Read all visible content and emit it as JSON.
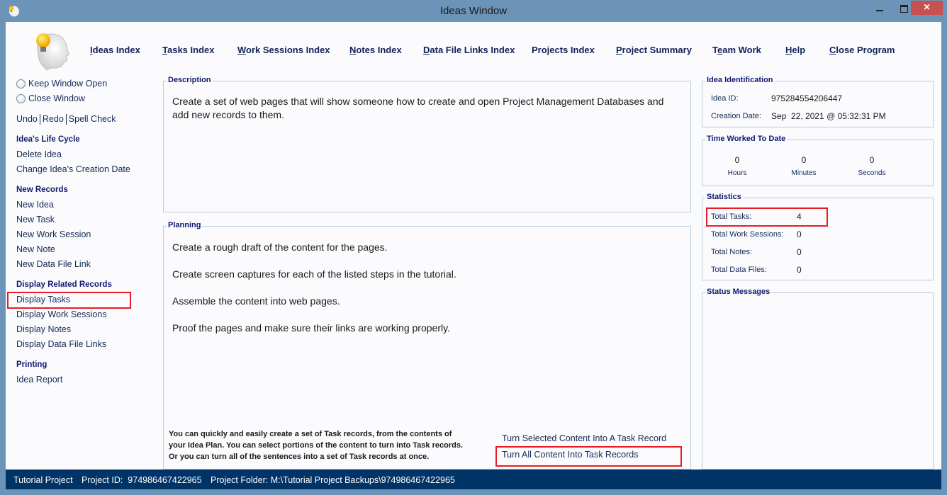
{
  "window": {
    "title": "Ideas Window",
    "icon": "idea-head-icon",
    "controls": {
      "minimize": "minimize-icon",
      "maximize": "maximize-icon",
      "close": "×"
    }
  },
  "nav": [
    {
      "label": "Ideas Index",
      "key": "I"
    },
    {
      "label": "Tasks Index",
      "key": "T"
    },
    {
      "label": "Work Sessions Index",
      "key": "W"
    },
    {
      "label": "Notes Index",
      "key": "N"
    },
    {
      "label": "Data File Links Index",
      "key": "D"
    },
    {
      "label": "Projects Index",
      "key": ""
    },
    {
      "label": "Project Summary",
      "key": "P"
    },
    {
      "label": "Team Work",
      "key": "e"
    },
    {
      "label": "Help",
      "key": "H"
    },
    {
      "label": "Close Program",
      "key": "C"
    }
  ],
  "sidebar": {
    "radios": [
      "Keep Window Open",
      "Close Window"
    ],
    "edit": [
      "Undo",
      "Redo",
      "Spell Check"
    ],
    "sections": [
      {
        "heading": "Idea's Life Cycle",
        "items": [
          "Delete Idea",
          "Change Idea's Creation Date"
        ]
      },
      {
        "heading": "New Records",
        "items": [
          "New Idea",
          "New Task",
          "New Work Session",
          "New Note",
          "New Data File Link"
        ]
      },
      {
        "heading": "Display Related Records",
        "items": [
          "Display Tasks",
          "Display Work Sessions",
          "Display Notes",
          "Display Data File Links"
        ]
      },
      {
        "heading": "Printing",
        "items": [
          "Idea Report"
        ]
      }
    ]
  },
  "description": {
    "legend": "Description",
    "lines": [
      "Create a set of web pages that will show someone how to create and open Project Management Databases and",
      "add new records to them."
    ]
  },
  "planning": {
    "legend": "Planning",
    "lines": [
      "Create a rough draft of the content for the pages.",
      "Create screen captures for each of the listed steps in the tutorial.",
      "Assemble the content into web pages.",
      "Proof the pages and make sure their links are working properly."
    ],
    "hint": [
      "You can quickly and easily create a set of Task records, from the contents of",
      "your Idea Plan. You can select portions of the content to turn into Task records.",
      "Or you can turn all of the sentences into a set of Task records at once."
    ],
    "actions": [
      "Turn Selected Content Into A Task Record",
      "Turn All Content Into Task Records"
    ]
  },
  "identification": {
    "legend": "Idea Identification",
    "id_label": "Idea ID:",
    "id_value": "975284554206447",
    "date_label": "Creation Date:",
    "date_value": "Sep  22, 2021 @ 05:32:31 PM"
  },
  "time_worked": {
    "legend": "Time Worked To Date",
    "values": [
      {
        "value": "0",
        "unit": "Hours"
      },
      {
        "value": "0",
        "unit": "Minutes"
      },
      {
        "value": "0",
        "unit": "Seconds"
      }
    ]
  },
  "statistics": {
    "legend": "Statistics",
    "rows": [
      {
        "label": "Total Tasks:",
        "value": "4"
      },
      {
        "label": "Total Work Sessions:",
        "value": "0"
      },
      {
        "label": "Total Notes:",
        "value": "0"
      },
      {
        "label": "Total Data Files:",
        "value": "0"
      }
    ]
  },
  "status_messages": {
    "legend": "Status Messages"
  },
  "statusbar": {
    "project": "Tutorial Project",
    "project_id": "Project ID:  974986467422965",
    "project_folder": "Project Folder: M:\\Tutorial Project Backups\\974986467422965"
  },
  "highlight_color": "#e81c24"
}
